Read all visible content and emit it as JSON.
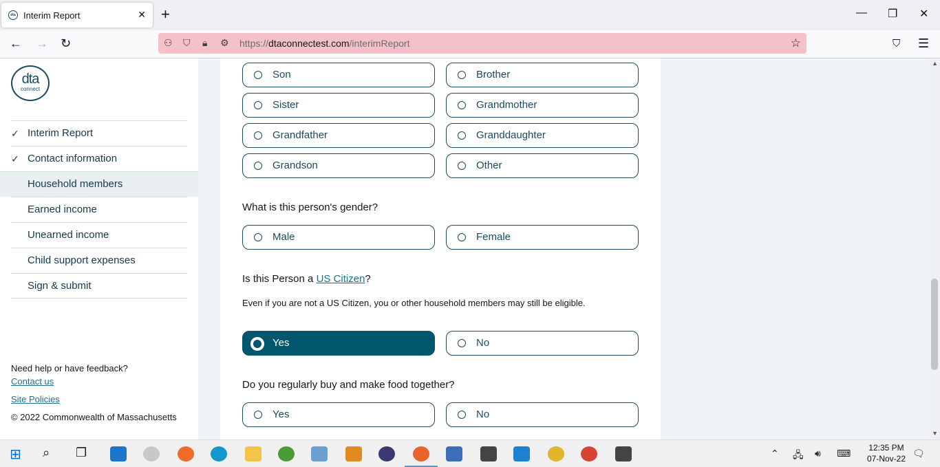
{
  "browser": {
    "tab_title": "Interim Report",
    "tab_favicon_text": "dta",
    "url_host": "dtaconnectest.com",
    "url_prefix": "https://",
    "url_path": "/interimReport"
  },
  "sidebar": {
    "logo_line1": "dta",
    "logo_line2": "connect",
    "items": [
      {
        "label": "Interim Report",
        "checked": true
      },
      {
        "label": "Contact information",
        "checked": true
      },
      {
        "label": "Household members",
        "checked": false
      },
      {
        "label": "Earned income",
        "checked": false
      },
      {
        "label": "Unearned income",
        "checked": false
      },
      {
        "label": "Child support expenses",
        "checked": false
      },
      {
        "label": "Sign & submit",
        "checked": false
      }
    ],
    "help_text": "Need help or have feedback?",
    "contact_link": "Contact us",
    "policies_link": "Site Policies",
    "copyright": "© 2022 Commonwealth of Massachusetts"
  },
  "form": {
    "relationship_options": [
      "Son",
      "Brother",
      "Sister",
      "Grandmother",
      "Grandfather",
      "Granddaughter",
      "Grandson",
      "Other"
    ],
    "gender_question": "What is this person's gender?",
    "gender_options": [
      "Male",
      "Female"
    ],
    "citizen_question_prefix": "Is this Person a ",
    "citizen_link": "US Citizen",
    "citizen_question_suffix": "?",
    "citizen_note": "Even if you are not a US Citizen, you or other household members may still be eligible.",
    "citizen_options": [
      "Yes",
      "No"
    ],
    "citizen_selected": "Yes",
    "food_question": "Do you regularly buy and make food together?",
    "food_options": [
      "Yes",
      "No"
    ]
  },
  "taskbar": {
    "time": "12:35 PM",
    "date": "07-Nov-22"
  }
}
